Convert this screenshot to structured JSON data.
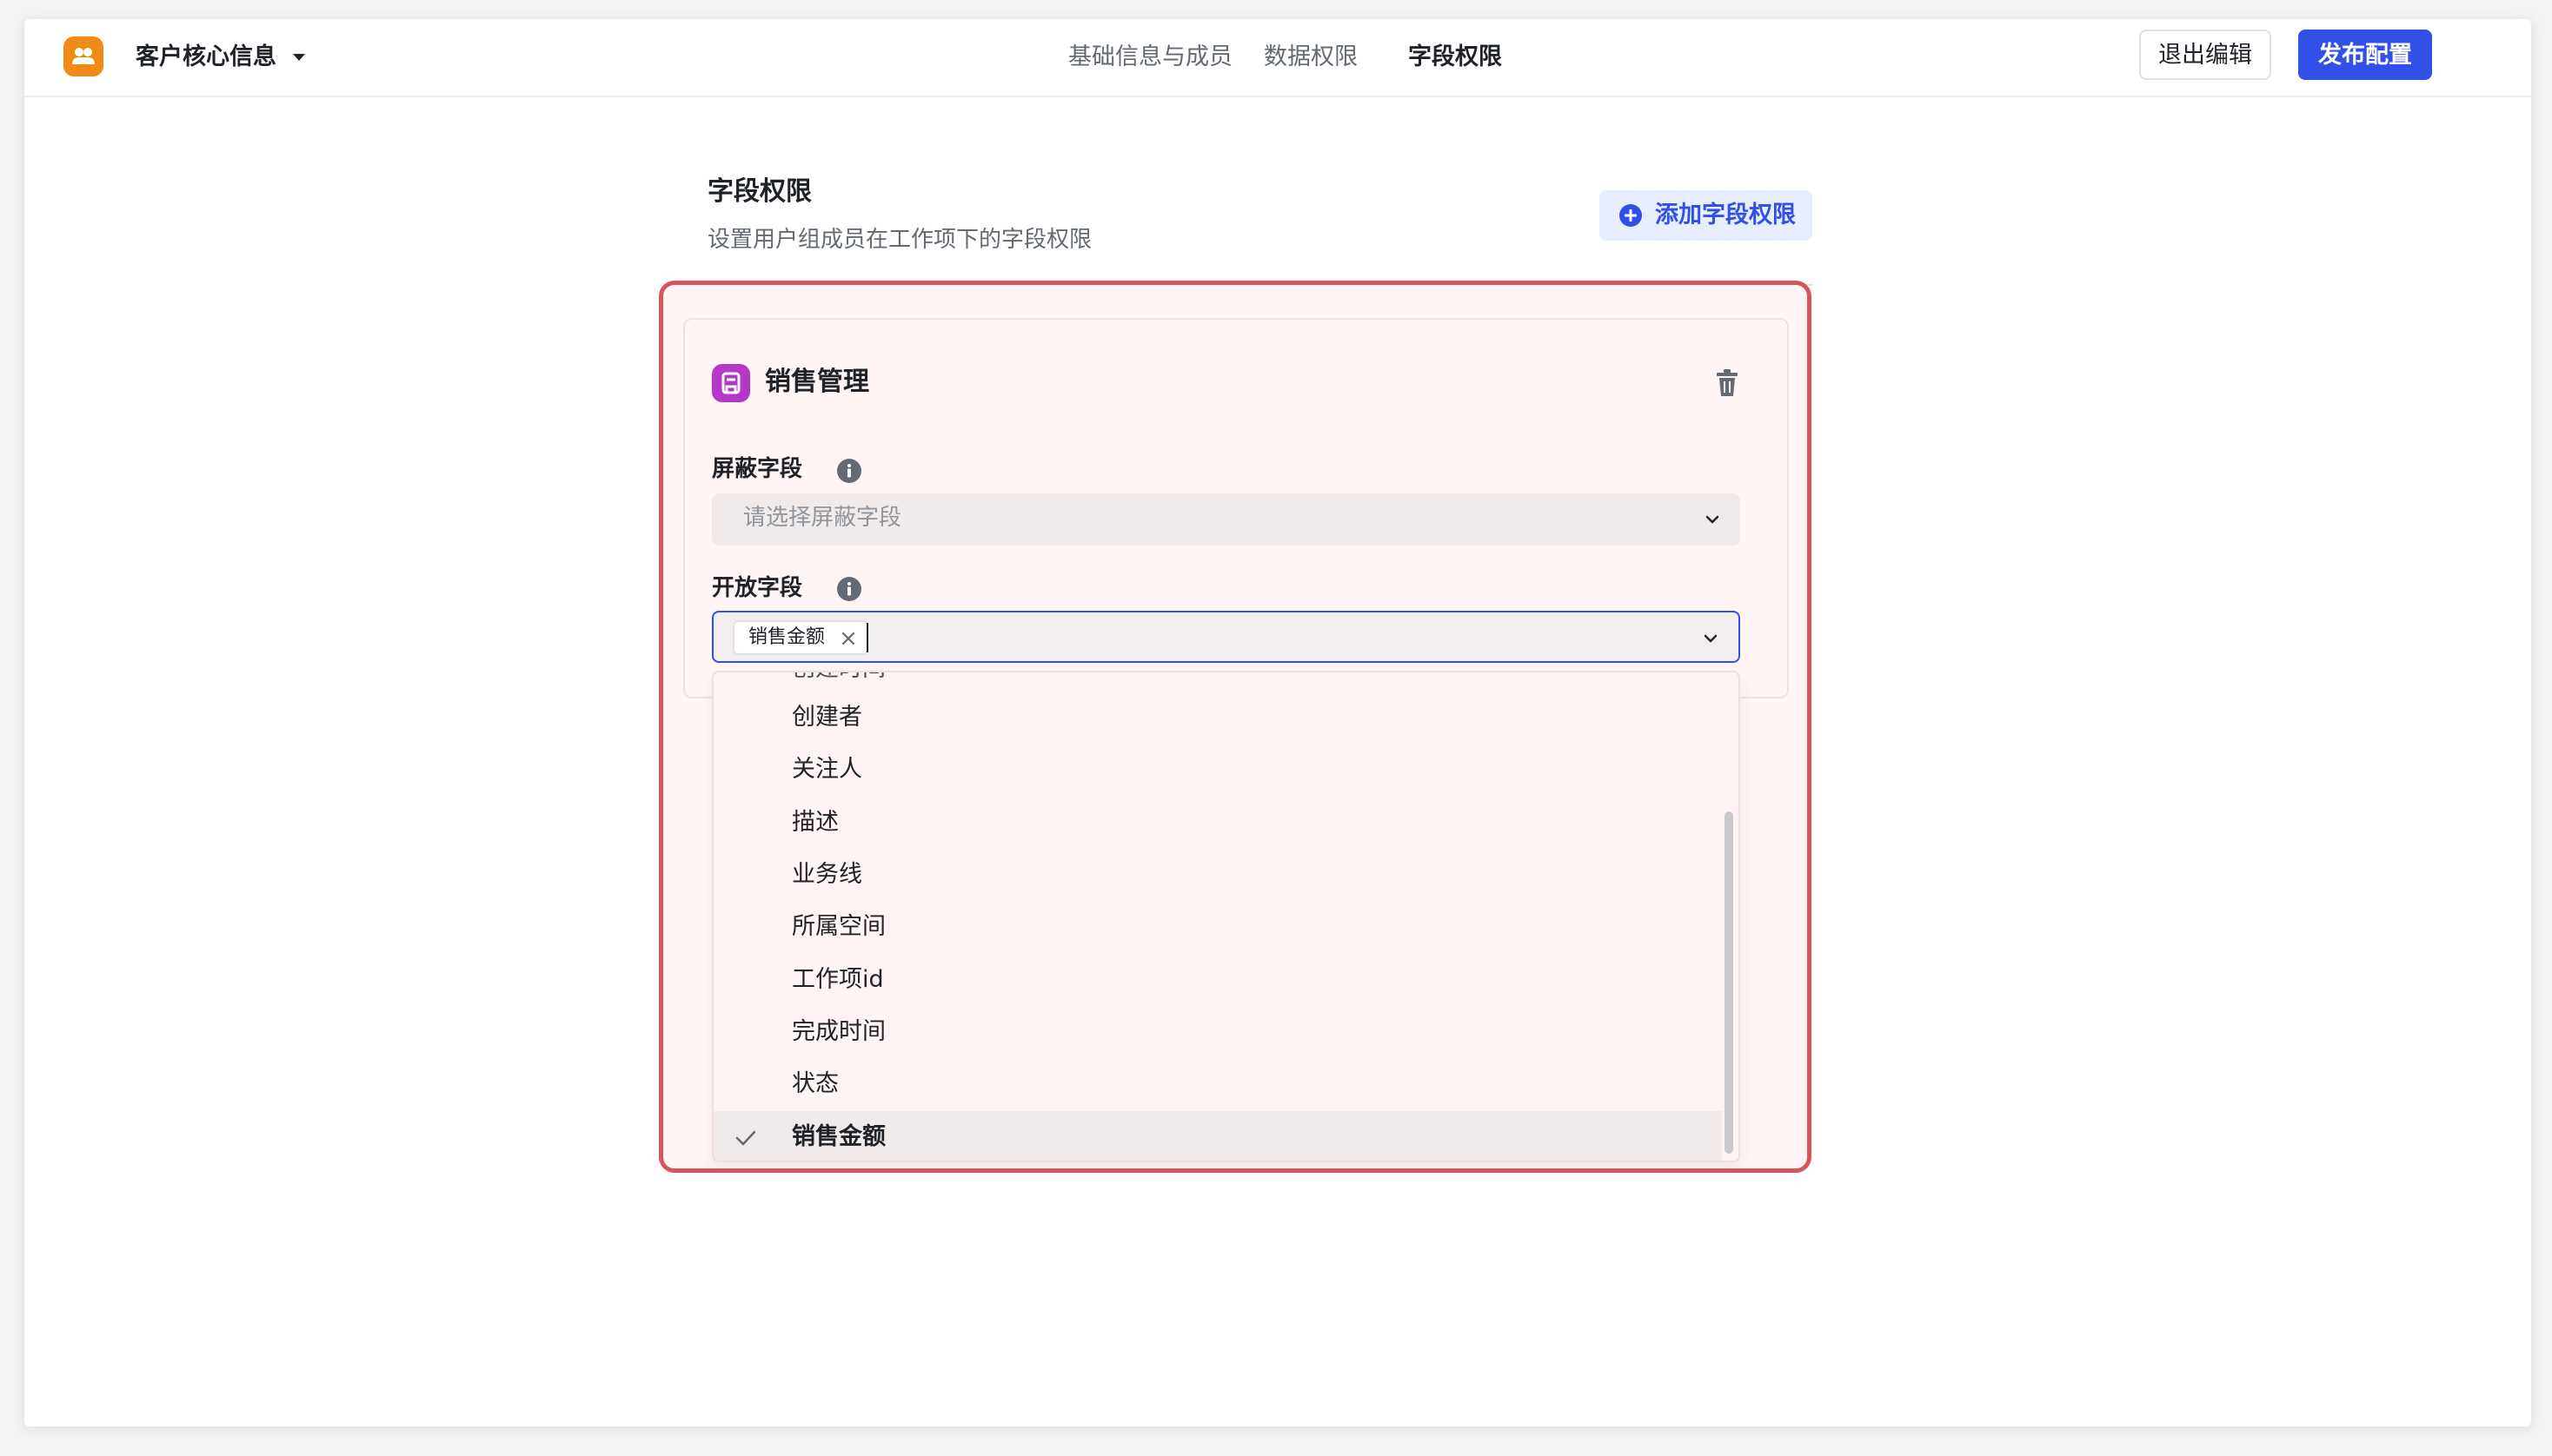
{
  "header": {
    "app_title": "客户核心信息",
    "tabs": [
      {
        "label": "基础信息与成员",
        "active": false
      },
      {
        "label": "数据权限",
        "active": false
      },
      {
        "label": "字段权限",
        "active": true
      }
    ],
    "exit_label": "退出编辑",
    "publish_label": "发布配置"
  },
  "section": {
    "title": "字段权限",
    "description": "设置用户组成员在工作项下的字段权限",
    "add_label": "添加字段权限"
  },
  "card": {
    "title": "销售管理",
    "hidden_fields": {
      "label": "屏蔽字段",
      "placeholder": "请选择屏蔽字段"
    },
    "open_fields": {
      "label": "开放字段",
      "selected_tag": "销售金额"
    }
  },
  "dropdown": {
    "partial_option": "创建时间",
    "options": [
      {
        "label": "创建者",
        "selected": false
      },
      {
        "label": "关注人",
        "selected": false
      },
      {
        "label": "描述",
        "selected": false
      },
      {
        "label": "业务线",
        "selected": false
      },
      {
        "label": "所属空间",
        "selected": false
      },
      {
        "label": "工作项id",
        "selected": false
      },
      {
        "label": "完成时间",
        "selected": false
      },
      {
        "label": "状态",
        "selected": false
      },
      {
        "label": "销售金额",
        "selected": true
      }
    ]
  },
  "colors": {
    "primary": "#3250e7",
    "app_icon": "#f08b17",
    "card_icon": "#b537c8",
    "highlight_border": "#d8555a"
  }
}
